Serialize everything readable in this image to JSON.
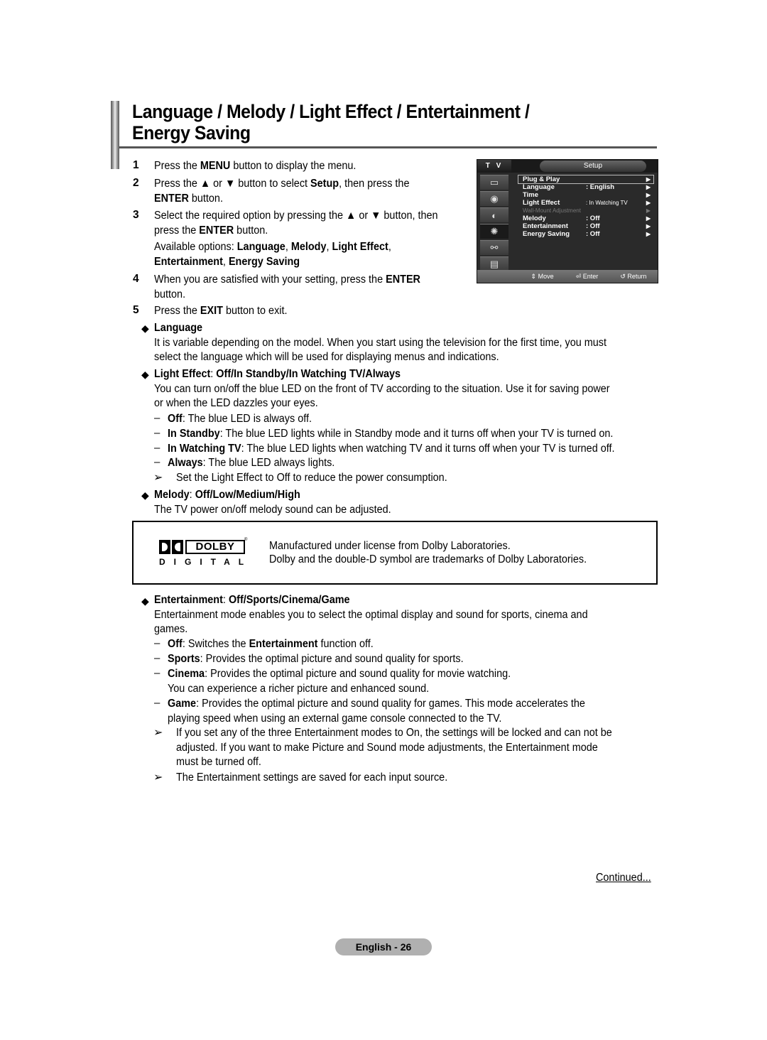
{
  "title": {
    "line1": "Language / Melody / Light Effect / Entertainment /",
    "line2": "Energy Saving"
  },
  "steps": [
    {
      "num": "1",
      "pre": "Press the ",
      "b1": "MENU",
      "post": " button to display the menu."
    },
    {
      "num": "2",
      "line1_pre": "Press the ▲ or ▼ button to select ",
      "line1_b": "Setup",
      "line1_post": ", then press the",
      "line2_b": "ENTER",
      "line2_post": " button."
    },
    {
      "num": "3",
      "line1": "Select the required option by pressing the ▲ or ▼ button, then",
      "line2_pre": "press the ",
      "line2_b": "ENTER",
      "line2_post": " button.",
      "options_pre": "Available options: ",
      "options": [
        "Language",
        "Melody",
        "Light Effect",
        "Entertainment",
        "Energy Saving"
      ]
    },
    {
      "num": "4",
      "line1_pre": "When you are satisfied with your setting, press the ",
      "line1_b": "ENTER",
      "line2": "button."
    },
    {
      "num": "5",
      "pre": "Press the ",
      "b1": "EXIT",
      "post": " button to exit."
    }
  ],
  "osd": {
    "tv_label": "T V",
    "header": "Setup",
    "side_icons": [
      "picture-icon",
      "sound-icon",
      "channel-icon",
      "setup-icon",
      "input-icon",
      "application-icon"
    ],
    "active_icon_index": 3,
    "rows": [
      {
        "label": "Plug & Play",
        "value": "",
        "selected": true,
        "dim": false
      },
      {
        "label": "Language",
        "value": ": English",
        "selected": false,
        "dim": false
      },
      {
        "label": "Time",
        "value": "",
        "selected": false,
        "dim": false
      },
      {
        "label": "Light Effect",
        "value": ": In Watching TV",
        "selected": false,
        "dim": false
      },
      {
        "label": "Wall-Mount Adjustment",
        "value": "",
        "selected": false,
        "dim": true
      },
      {
        "label": "Melody",
        "value": ": Off",
        "selected": false,
        "dim": false
      },
      {
        "label": "Entertainment",
        "value": ": Off",
        "selected": false,
        "dim": false
      },
      {
        "label": "Energy Saving",
        "value": ": Off",
        "selected": false,
        "dim": false
      }
    ],
    "footer": {
      "move": "Move",
      "enter": "Enter",
      "return": "Return"
    }
  },
  "sections": {
    "language": {
      "heading": "Language",
      "body1": "It is variable depending on the model. When you start using the television for the first time, you must",
      "body2": "select the language which will be used for displaying menus and indications."
    },
    "light_effect": {
      "heading_b1": "Light Effect",
      "heading_rest": ": ",
      "heading_b2": "Off/In Standby/In Watching TV/Always",
      "body1": "You can turn on/off the blue LED on the front of TV according to the situation. Use it for saving power",
      "body2": "or when the LED dazzles your eyes.",
      "items": [
        {
          "term": "Off",
          "desc": ": The blue LED is always off."
        },
        {
          "term": "In Standby",
          "desc": ": The blue LED lights while in Standby mode and it turns off when your TV is turned on."
        },
        {
          "term": "In Watching TV",
          "desc": ": The blue LED lights when watching TV and it turns off when your TV is turned off."
        },
        {
          "term": "Always",
          "desc": ": The blue LED always lights."
        }
      ],
      "note": "Set the Light Effect to Off to reduce the power consumption."
    },
    "melody": {
      "heading_b1": "Melody",
      "heading_rest": ": ",
      "heading_b2": "Off/Low/Medium/High",
      "body": "The TV power on/off melody sound can be adjusted."
    },
    "dolby": {
      "logo_word": "DOLBY",
      "logo_sub": "DIGITAL",
      "reg": "®",
      "line1": "Manufactured under license from Dolby Laboratories.",
      "line2": "Dolby and the double-D symbol are trademarks of Dolby Laboratories."
    },
    "entertainment": {
      "heading_b1": "Entertainment",
      "heading_rest": ": ",
      "heading_b2": "Off/Sports/Cinema/Game",
      "body1": "Entertainment mode enables you to select the optimal display and sound for sports, cinema and",
      "body2": "games.",
      "off_term": "Off",
      "off_pre": ": Switches the ",
      "off_b": "Entertainment",
      "off_post": " function off.",
      "sports_term": "Sports",
      "sports_desc": ": Provides the optimal picture and sound quality for sports.",
      "cinema_term": "Cinema",
      "cinema_desc": ": Provides the optimal picture and sound quality for movie watching.",
      "cinema_desc2": "You can experience a richer picture and enhanced sound.",
      "game_term": "Game",
      "game_desc": ": Provides the optimal picture and sound quality for games. This mode accelerates the",
      "game_desc2": "playing speed when using an external game console connected to the TV.",
      "note1_l1": "If you set any of the three Entertainment modes to On, the settings will be locked and can not be",
      "note1_l2": "adjusted. If you want to make Picture and Sound mode adjustments, the Entertainment mode",
      "note1_l3": "must be turned off.",
      "note2": "The Entertainment settings are saved for each input source."
    }
  },
  "footer": {
    "continued": "Continued...",
    "page_label": "English - 26"
  }
}
